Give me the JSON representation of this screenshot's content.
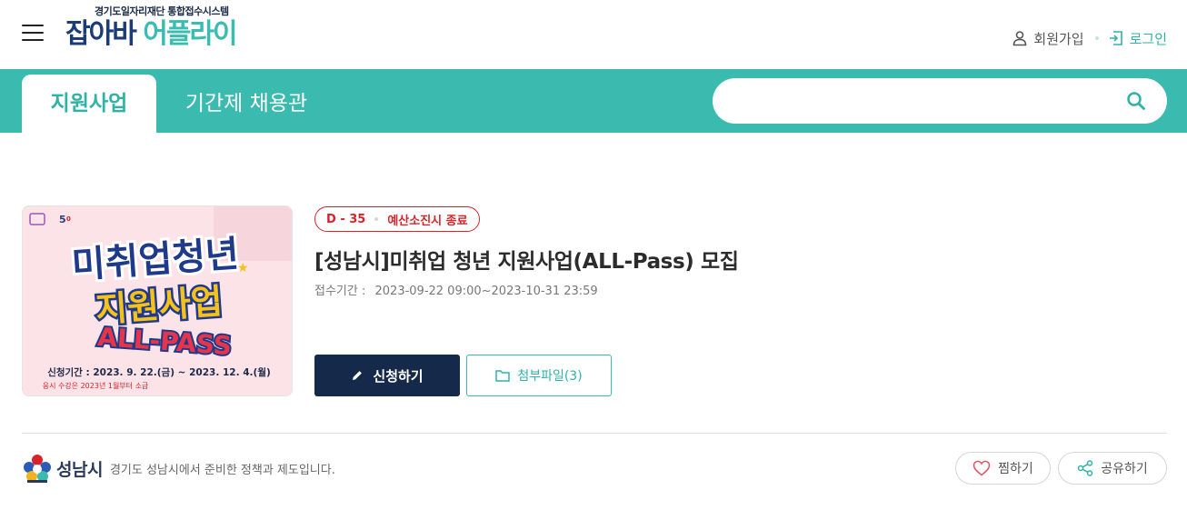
{
  "header": {
    "logo_subtitle": "경기도일자리재단 통합접수시스템",
    "logo_text_a": "잡아바 ",
    "logo_text_b": "어플라이",
    "signup_label": "회원가입",
    "login_label": "로그인"
  },
  "nav": {
    "tabs": [
      {
        "label": "지원사업",
        "active": true
      },
      {
        "label": "기간제 채용관",
        "active": false
      }
    ],
    "search": {
      "value": "",
      "placeholder": ""
    }
  },
  "post": {
    "dday": "D - 35",
    "status": "예산소진시 종료",
    "title": "[성남시]미취업 청년 지원사업(ALL-Pass) 모집",
    "period_label": "접수기간 :",
    "period_value": "2023-09-22 09:00~2023-10-31 23:59",
    "apply_label": "신청하기",
    "files_label": "첨부파일(3)",
    "thumbnail": {
      "line1": "미취업청년",
      "line2": "지원사업",
      "line3": "ALL-PASS",
      "dates": "신청기간 : 2023. 9. 22.(금) ~ 2023. 12. 4.(월)",
      "note": "응시 수강은 2023년 1월부터 소급"
    }
  },
  "footer": {
    "org_name": "성남시",
    "org_desc": "경기도 성남시에서 준비한 정책과 제도입니다.",
    "like_label": "찜하기",
    "share_label": "공유하기"
  },
  "colors": {
    "brand_teal": "#3bbab0",
    "navy": "#15294a",
    "alert_red": "#d8232a"
  },
  "icons": [
    "menu-icon",
    "user-icon",
    "login-icon",
    "search-icon",
    "pencil-icon",
    "folder-icon",
    "heart-icon",
    "share-icon"
  ]
}
